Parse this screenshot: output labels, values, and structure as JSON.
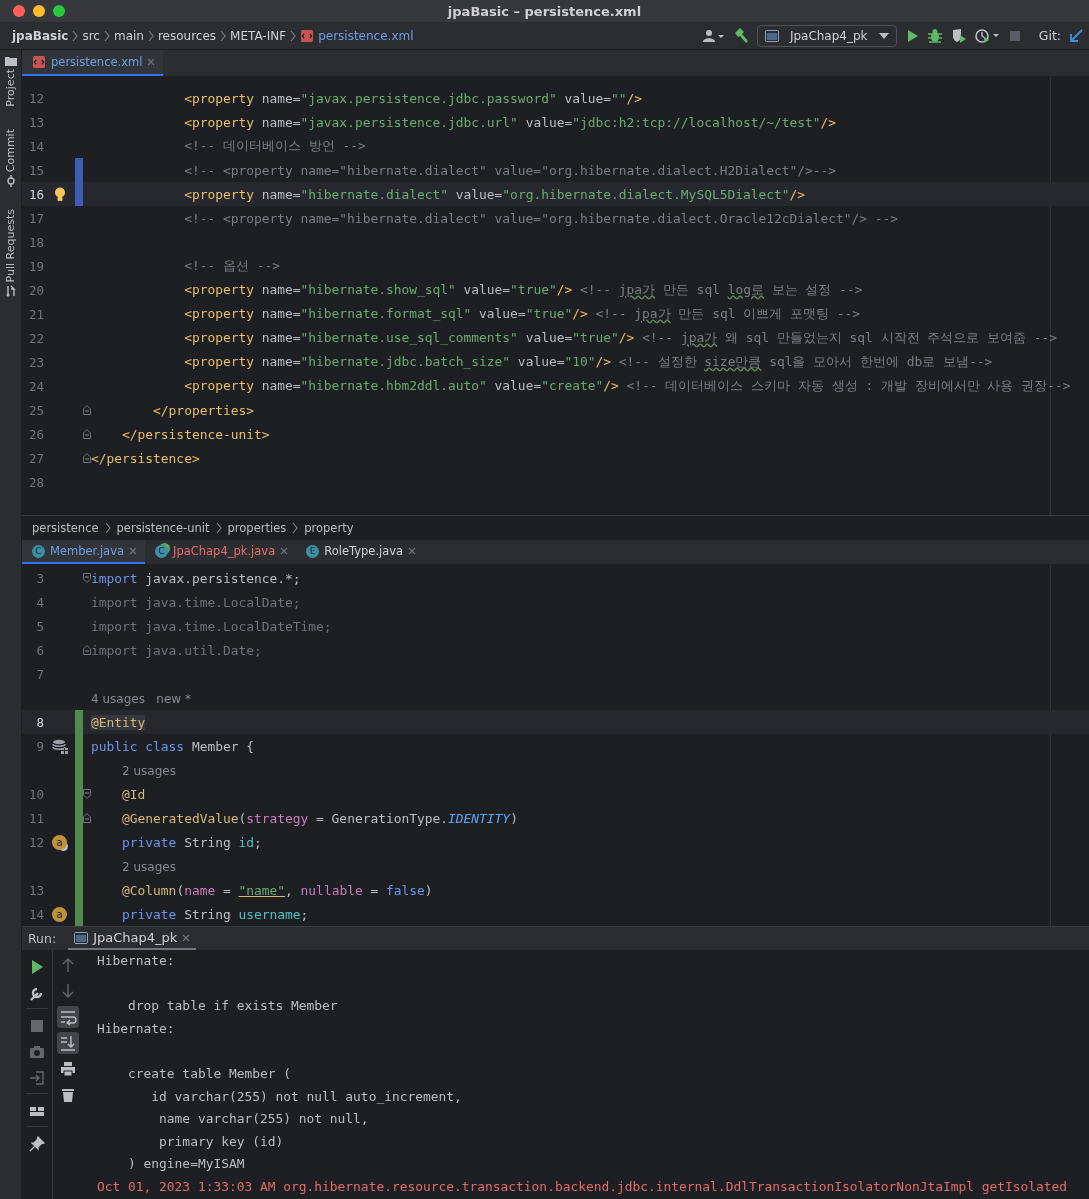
{
  "window": {
    "title": "jpaBasic – persistence.xml"
  },
  "navbar": {
    "breadcrumbs": [
      {
        "label": "jpaBasic",
        "kind": "project"
      },
      {
        "label": "src",
        "kind": "folder"
      },
      {
        "label": "main",
        "kind": "folder"
      },
      {
        "label": "resources",
        "kind": "folder"
      },
      {
        "label": "META-INF",
        "kind": "folder"
      },
      {
        "label": "persistence.xml",
        "kind": "file"
      }
    ],
    "run_config": "JpaChap4_pk",
    "vcs_label": "Git:"
  },
  "tool_strip": [
    {
      "label": "Project",
      "kind": "project"
    },
    {
      "label": "Commit",
      "kind": "commit"
    },
    {
      "label": "Pull Requests",
      "kind": "pull-requests"
    }
  ],
  "xml_editor": {
    "tabs": [
      {
        "label": "persistence.xml",
        "selected": true,
        "color": "#6e9fe6",
        "icon": {
          "kind": "xml"
        }
      }
    ],
    "lines": [
      {
        "number": "12",
        "current": false,
        "modified": false,
        "fold_start": false,
        "fold_end": false,
        "tokens": [
          {
            "kind": "tag",
            "text": "            <property"
          },
          {
            "kind": "attr",
            "text": " name="
          },
          {
            "kind": "str",
            "text": "\"javax.persistence.jdbc.password\""
          },
          {
            "kind": "attr",
            "text": " value="
          },
          {
            "kind": "str",
            "text": "\"\""
          },
          {
            "kind": "tag",
            "text": "/>"
          }
        ]
      },
      {
        "number": "13",
        "current": false,
        "modified": false,
        "fold_start": false,
        "fold_end": false,
        "tokens": [
          {
            "kind": "tag",
            "text": "            <property"
          },
          {
            "kind": "attr",
            "text": " name="
          },
          {
            "kind": "str",
            "text": "\"javax.persistence.jdbc.url\""
          },
          {
            "kind": "attr",
            "text": " value="
          },
          {
            "kind": "str",
            "text": "\"jdbc:h2:tcp://localhost/~/test\""
          },
          {
            "kind": "tag",
            "text": "/>"
          }
        ]
      },
      {
        "number": "14",
        "current": false,
        "modified": false,
        "fold_start": false,
        "fold_end": false,
        "tokens": [
          {
            "kind": "cm",
            "text": "            <!-- 데이터베이스 방언 -->"
          }
        ]
      },
      {
        "number": "15",
        "current": false,
        "modified": true,
        "fold_start": false,
        "fold_end": false,
        "tokens": [
          {
            "kind": "cm",
            "text": "            <!-- <property name=\"hibernate.dialect\" value=\"org.hibernate.dialect.H2Dialect\"/>-->"
          }
        ]
      },
      {
        "number": "16",
        "current": true,
        "modified": true,
        "fold_start": false,
        "fold_end": false,
        "marker": {
          "kind": "bulb"
        },
        "tokens": [
          {
            "kind": "tag",
            "text": "            <property"
          },
          {
            "kind": "attr",
            "text": " name="
          },
          {
            "kind": "str",
            "text": "\"hibernate.dialect\""
          },
          {
            "kind": "attr",
            "text": " value="
          },
          {
            "kind": "str",
            "text": "\"org.hibernate.dialect.MySQL5Dialect\""
          },
          {
            "kind": "tag",
            "text": "/>"
          }
        ]
      },
      {
        "number": "17",
        "current": false,
        "modified": false,
        "fold_start": false,
        "fold_end": false,
        "tokens": [
          {
            "kind": "cm",
            "text": "            <!-- <property name=\"hibernate.dialect\" value=\"org.hibernate.dialect.Oracle12cDialect\"/> -->"
          }
        ]
      },
      {
        "number": "18",
        "current": false,
        "modified": false,
        "fold_start": false,
        "fold_end": false
      },
      {
        "number": "19",
        "current": false,
        "modified": false,
        "fold_start": false,
        "fold_end": false,
        "tokens": [
          {
            "kind": "cm",
            "text": "            <!-- 옵션 -->"
          }
        ]
      },
      {
        "number": "20",
        "current": false,
        "modified": false,
        "fold_start": false,
        "fold_end": false,
        "tokens": [
          {
            "kind": "tag",
            "text": "            <property"
          },
          {
            "kind": "attr",
            "text": " name="
          },
          {
            "kind": "str",
            "text": "\"hibernate.show_sql\""
          },
          {
            "kind": "attr",
            "text": " value="
          },
          {
            "kind": "str",
            "text": "\"true\""
          },
          {
            "kind": "tag",
            "text": "/>"
          },
          {
            "kind": "cm",
            "text": " <!-- "
          },
          {
            "kind": "typo",
            "text": "jpa가"
          },
          {
            "kind": "cm",
            "text": " 만든 sql "
          },
          {
            "kind": "typo",
            "text": "log로"
          },
          {
            "kind": "cm",
            "text": " 보는 설정 -->"
          }
        ]
      },
      {
        "number": "21",
        "current": false,
        "modified": false,
        "fold_start": false,
        "fold_end": false,
        "tokens": [
          {
            "kind": "tag",
            "text": "            <property"
          },
          {
            "kind": "attr",
            "text": " name="
          },
          {
            "kind": "str",
            "text": "\"hibernate.format_sql\""
          },
          {
            "kind": "attr",
            "text": " value="
          },
          {
            "kind": "str",
            "text": "\"true\""
          },
          {
            "kind": "tag",
            "text": "/>"
          },
          {
            "kind": "cm",
            "text": " <!-- "
          },
          {
            "kind": "typo",
            "text": "jpa가"
          },
          {
            "kind": "cm",
            "text": " 만든 sql 이쁘게 포맷팅 -->"
          }
        ]
      },
      {
        "number": "22",
        "current": false,
        "modified": false,
        "fold_start": false,
        "fold_end": false,
        "tokens": [
          {
            "kind": "tag",
            "text": "            <property"
          },
          {
            "kind": "attr",
            "text": " name="
          },
          {
            "kind": "str",
            "text": "\"hibernate.use_sql_comments\""
          },
          {
            "kind": "attr",
            "text": " value="
          },
          {
            "kind": "str",
            "text": "\"true\""
          },
          {
            "kind": "tag",
            "text": "/>"
          },
          {
            "kind": "cm",
            "text": " <!-- "
          },
          {
            "kind": "typo",
            "text": "jpa가"
          },
          {
            "kind": "cm",
            "text": " 왜 sql 만들었는지 sql 시작전 주석으로 보여줌 -->"
          }
        ]
      },
      {
        "number": "23",
        "current": false,
        "modified": false,
        "fold_start": false,
        "fold_end": false,
        "tokens": [
          {
            "kind": "tag",
            "text": "            <property"
          },
          {
            "kind": "attr",
            "text": " name="
          },
          {
            "kind": "str",
            "text": "\"hibernate.jdbc.batch_size\""
          },
          {
            "kind": "attr",
            "text": " value="
          },
          {
            "kind": "str",
            "text": "\"10\""
          },
          {
            "kind": "tag",
            "text": "/>"
          },
          {
            "kind": "cm",
            "text": " <!-- 설정한 "
          },
          {
            "kind": "typo",
            "text": "size만큼"
          },
          {
            "kind": "cm",
            "text": " sql을 모아서 한번에 db로 보냄-->"
          }
        ]
      },
      {
        "number": "24",
        "current": false,
        "modified": false,
        "fold_start": false,
        "fold_end": false,
        "tokens": [
          {
            "kind": "tag",
            "text": "            <property"
          },
          {
            "kind": "attr",
            "text": " name="
          },
          {
            "kind": "str",
            "text": "\"hibernate.hbm2ddl.auto\""
          },
          {
            "kind": "attr",
            "text": " value="
          },
          {
            "kind": "str",
            "text": "\"create\""
          },
          {
            "kind": "tag",
            "text": "/>"
          },
          {
            "kind": "cm",
            "text": " <!-- 데이터베이스 스키마 자동 생성 : 개발 장비에서만 사용 권장-->"
          }
        ]
      },
      {
        "number": "25",
        "current": false,
        "modified": false,
        "fold_start": false,
        "fold_end": true,
        "tokens": [
          {
            "kind": "tag",
            "text": "        </properties>"
          }
        ]
      },
      {
        "number": "26",
        "current": false,
        "modified": false,
        "fold_start": false,
        "fold_end": true,
        "tokens": [
          {
            "kind": "tag",
            "text": "    </persistence-unit>"
          }
        ]
      },
      {
        "number": "27",
        "current": false,
        "modified": false,
        "fold_start": false,
        "fold_end": true,
        "tokens": [
          {
            "kind": "tag",
            "text": "</persistence>"
          }
        ]
      },
      {
        "number": "28",
        "current": false,
        "modified": false,
        "fold_start": false,
        "fold_end": false
      }
    ],
    "breadcrumbs": [
      "persistence",
      "persistence-unit",
      "properties",
      "property"
    ]
  },
  "java_editor": {
    "tabs": [
      {
        "label": "Member.java",
        "selected": true,
        "color": "#6e9fe6",
        "icon": {
          "kind": "class",
          "letter": "C"
        }
      },
      {
        "label": "JpaChap4_pk.java",
        "selected": false,
        "color": "#e86c6c",
        "icon": {
          "kind": "main",
          "letter": "C"
        }
      },
      {
        "label": "RoleType.java",
        "selected": false,
        "color": "#cfd1d6",
        "icon": {
          "kind": "enum",
          "letter": "E"
        }
      }
    ],
    "lines": [
      {
        "kind": "code",
        "number": "3",
        "current": false,
        "added": false,
        "fold_start": true,
        "fold_end": false,
        "tokens": [
          {
            "kind": "kw",
            "text": "import"
          },
          {
            "kind": "plain",
            "text": " javax.persistence.*;"
          }
        ]
      },
      {
        "kind": "code",
        "number": "4",
        "current": false,
        "added": false,
        "fold_start": false,
        "fold_end": false,
        "tokens": [
          {
            "kind": "dim",
            "text": "import java.time.LocalDate;"
          }
        ]
      },
      {
        "kind": "code",
        "number": "5",
        "current": false,
        "added": false,
        "fold_start": false,
        "fold_end": false,
        "tokens": [
          {
            "kind": "dim",
            "text": "import java.time.LocalDateTime;"
          }
        ]
      },
      {
        "kind": "code",
        "number": "6",
        "current": false,
        "added": false,
        "fold_start": false,
        "fold_end": true,
        "tokens": [
          {
            "kind": "dim",
            "text": "import java.util.Date;"
          }
        ]
      },
      {
        "kind": "code",
        "number": "7",
        "current": false,
        "added": false,
        "fold_start": false,
        "fold_end": false
      },
      {
        "kind": "hint",
        "current": false,
        "added": false,
        "fold_start": false,
        "fold_end": false,
        "text": "4 usages   new *"
      },
      {
        "kind": "code",
        "number": "8",
        "current": true,
        "added": true,
        "fold_start": false,
        "fold_end": false,
        "tokens": [
          {
            "kind": "ann",
            "text": "@Entity"
          }
        ]
      },
      {
        "kind": "code",
        "number": "9",
        "current": false,
        "added": true,
        "fold_start": false,
        "fold_end": false,
        "marker": {
          "kind": "entity"
        },
        "tokens": [
          {
            "kind": "kw",
            "text": "public class"
          },
          {
            "kind": "plain",
            "text": " Member {"
          }
        ]
      },
      {
        "kind": "hint",
        "current": false,
        "added": true,
        "fold_start": false,
        "fold_end": false,
        "text": "    2 usages"
      },
      {
        "kind": "code",
        "number": "10",
        "current": false,
        "added": true,
        "fold_start": true,
        "fold_end": false,
        "tokens": [
          {
            "kind": "ann",
            "text": "    @Id"
          }
        ]
      },
      {
        "kind": "code",
        "number": "11",
        "current": false,
        "added": true,
        "fold_start": false,
        "fold_end": true,
        "tokens": [
          {
            "kind": "ann",
            "text": "    @GeneratedValue"
          },
          {
            "kind": "plain",
            "text": "("
          },
          {
            "kind": "param",
            "text": "strategy"
          },
          {
            "kind": "plain",
            "text": " = GenerationType."
          },
          {
            "kind": "const",
            "text": "IDENTITY"
          },
          {
            "kind": "plain",
            "text": ")"
          }
        ]
      },
      {
        "kind": "code",
        "number": "12",
        "current": false,
        "added": true,
        "fold_start": false,
        "fold_end": false,
        "marker": {
          "kind": "key-field",
          "letter": "a"
        },
        "tokens": [
          {
            "kind": "kw",
            "text": "    private"
          },
          {
            "kind": "plain",
            "text": " String "
          },
          {
            "kind": "field",
            "text": "id"
          },
          {
            "kind": "plain",
            "text": ";"
          }
        ]
      },
      {
        "kind": "hint",
        "current": false,
        "added": true,
        "fold_start": false,
        "fold_end": false,
        "text": "    2 usages"
      },
      {
        "kind": "code",
        "number": "13",
        "current": false,
        "added": true,
        "fold_start": false,
        "fold_end": false,
        "tokens": [
          {
            "kind": "ann",
            "text": "    @Column"
          },
          {
            "kind": "plain",
            "text": "("
          },
          {
            "kind": "param",
            "text": "name"
          },
          {
            "kind": "plain",
            "text": " = "
          },
          {
            "kind": "str",
            "text": "\"name\""
          },
          {
            "kind": "plain",
            "text": ", "
          },
          {
            "kind": "param",
            "text": "nullable"
          },
          {
            "kind": "plain",
            "text": " = "
          },
          {
            "kind": "kw",
            "text": "false"
          },
          {
            "kind": "plain",
            "text": ")"
          }
        ]
      },
      {
        "kind": "code",
        "number": "14",
        "current": false,
        "added": true,
        "fold_start": false,
        "fold_end": false,
        "marker": {
          "kind": "field",
          "letter": "a"
        },
        "tokens": [
          {
            "kind": "kw",
            "text": "    private"
          },
          {
            "kind": "plain",
            "text": " String "
          },
          {
            "kind": "field",
            "text": "username"
          },
          {
            "kind": "plain",
            "text": ";"
          }
        ]
      }
    ]
  },
  "run_panel": {
    "label": "Run:",
    "tabs": [
      {
        "label": "JpaChap4_pk",
        "selected": true
      }
    ],
    "toolbar": [
      [
        {
          "kind": "rerun",
          "disabled": false
        },
        {
          "kind": "settings",
          "disabled": false
        }
      ],
      [
        {
          "kind": "stop",
          "disabled": true
        },
        {
          "kind": "camera",
          "disabled": true
        },
        {
          "kind": "exit",
          "disabled": true
        }
      ],
      [
        {
          "kind": "layout",
          "disabled": false
        }
      ],
      [
        {
          "kind": "pin",
          "disabled": false
        }
      ]
    ],
    "output_toolbar": [
      {
        "kind": "up",
        "disabled": true,
        "on": false
      },
      {
        "kind": "down",
        "disabled": true,
        "on": false
      },
      {
        "kind": "wrap",
        "disabled": false,
        "on": true
      },
      {
        "kind": "scroll-end",
        "disabled": false,
        "on": true
      },
      {
        "kind": "print",
        "disabled": false,
        "on": false
      },
      {
        "kind": "trash",
        "disabled": false,
        "on": false
      }
    ],
    "output": [
      {
        "kind": "text",
        "text": "Hibernate:"
      },
      {
        "kind": "blank"
      },
      {
        "kind": "text",
        "text": "    drop table if exists Member"
      },
      {
        "kind": "text",
        "text": "Hibernate:"
      },
      {
        "kind": "blank"
      },
      {
        "kind": "text",
        "text": "    create table Member ("
      },
      {
        "kind": "text",
        "text": "       id varchar(255) not null auto_increment,"
      },
      {
        "kind": "text",
        "text": "        name varchar(255) not null,"
      },
      {
        "kind": "text",
        "text": "        primary key (id)"
      },
      {
        "kind": "text",
        "text": "    ) engine=MyISAM"
      },
      {
        "kind": "error",
        "text": "Oct 01, 2023 1:33:03 AM org.hibernate.resource.transaction.backend.jdbc.internal.DdlTransactionIsolatorNonJtaImpl getIsolated"
      }
    ]
  }
}
